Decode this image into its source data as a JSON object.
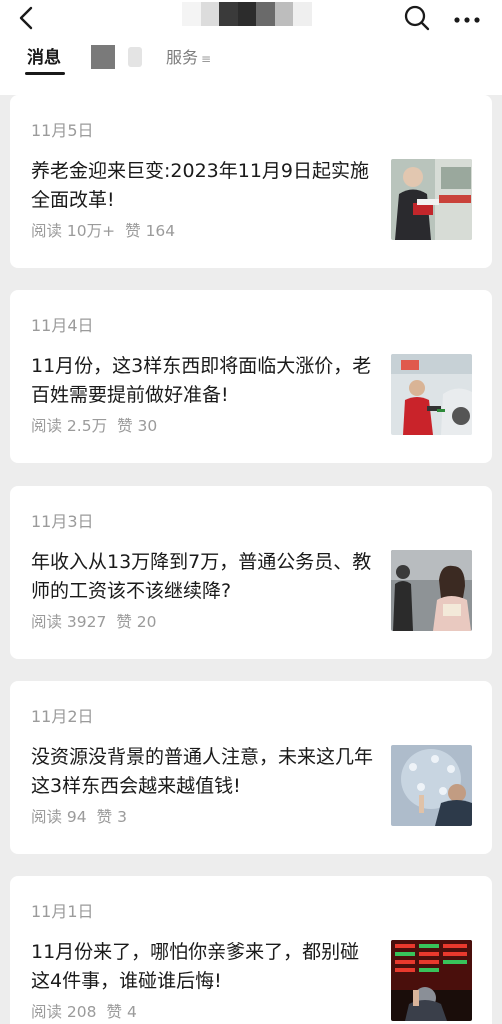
{
  "header": {
    "tabs": {
      "messages": "消息",
      "services": "服务",
      "services_icon": "≡"
    },
    "icons": {
      "back": "chevron-left-icon",
      "search": "search-icon",
      "more": "more-horizontal-icon"
    }
  },
  "articles": [
    {
      "date": "11月5日",
      "headline": "养老金迎来巨变:2023年11月9日起实施全面改革!",
      "reads": "阅读 10万+",
      "likes": "赞 164"
    },
    {
      "date": "11月4日",
      "headline": "11月份，这3样东西即将面临大涨价，老百姓需要提前做好准备!",
      "reads": "阅读 2.5万",
      "likes": "赞 30"
    },
    {
      "date": "11月3日",
      "headline": "年收入从13万降到7万，普通公务员、教师的工资该不该继续降?",
      "reads": "阅读 3927",
      "likes": "赞 20"
    },
    {
      "date": "11月2日",
      "headline": "没资源没背景的普通人注意，未来这几年这3样东西会越来越值钱!",
      "reads": "阅读 94",
      "likes": "赞 3"
    },
    {
      "date": "11月1日",
      "headline": "11月份来了，哪怕你亲爹来了，都别碰这4件事，谁碰谁后悔!",
      "reads": "阅读 208",
      "likes": "赞 4"
    }
  ]
}
